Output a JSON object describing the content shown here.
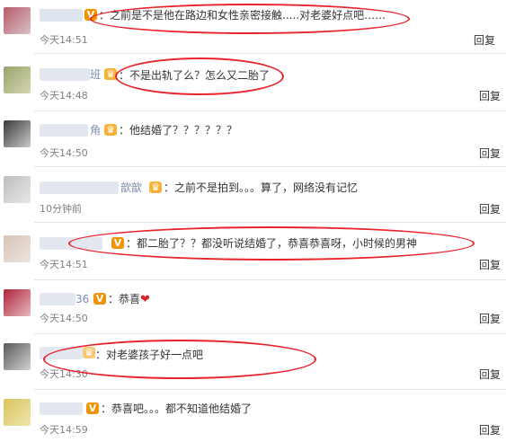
{
  "comments": [
    {
      "text": "：之前是不是他在路边和女性亲密接触.....对老婆好点吧……",
      "time": "今天14:51",
      "reply": "回复"
    },
    {
      "text": "：不是出轨了么？怎么又二胎了",
      "name_suffix": "班",
      "time": "今天14:48",
      "reply": "回复"
    },
    {
      "text": "：他结婚了？？？？？？",
      "name_suffix": "角",
      "time": "今天14:50",
      "reply": "回复"
    },
    {
      "text": "：之前不是拍到。。。算了，网络没有记忆",
      "name_suffix": "歆歆",
      "time": "10分钟前",
      "reply": "回复"
    },
    {
      "text": "：都二胎了？？都没听说结婚了，恭喜恭喜呀，小时候的男神",
      "time": "今天14:51",
      "reply": "回复"
    },
    {
      "text": "：恭喜",
      "name_suffix": "36",
      "time": "今天14:50",
      "reply": "回复"
    },
    {
      "text": "：对老婆孩子好一点吧",
      "time": "今天14:30",
      "reply": "回复"
    },
    {
      "text": "：恭喜吧。。。都不知道他结婚了",
      "time": "今天14:59",
      "reply": "回复"
    }
  ],
  "badges": {
    "v": "V",
    "crown": "♛"
  },
  "colors": {
    "annotation": "#e8232b",
    "name": "#eb7350"
  }
}
